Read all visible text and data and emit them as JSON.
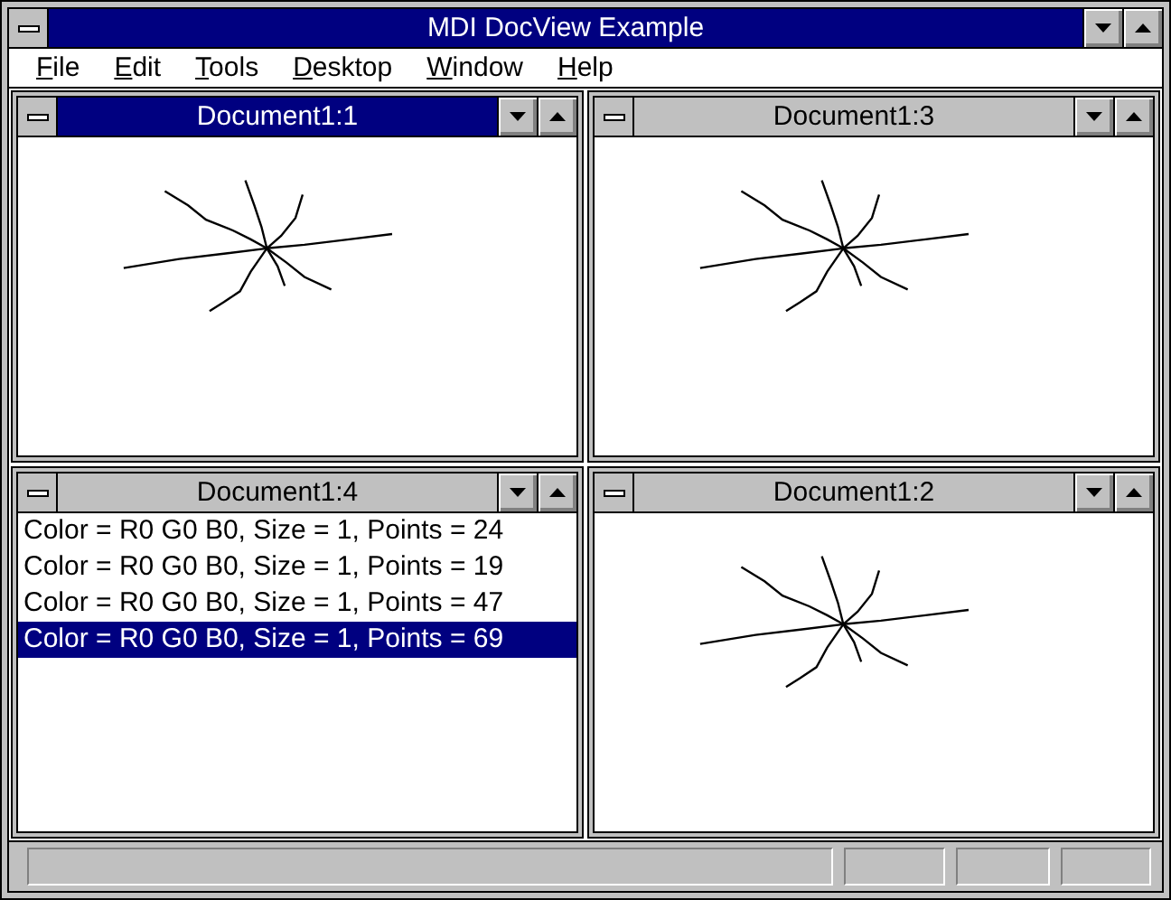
{
  "window": {
    "title": "MDI DocView Example"
  },
  "menu": [
    {
      "label": "File"
    },
    {
      "label": "Edit"
    },
    {
      "label": "Tools"
    },
    {
      "label": "Desktop"
    },
    {
      "label": "Window"
    },
    {
      "label": "Help"
    }
  ],
  "documents": [
    {
      "title": "Document1:1",
      "active": true,
      "kind": "sketch"
    },
    {
      "title": "Document1:3",
      "active": false,
      "kind": "sketch"
    },
    {
      "title": "Document1:4",
      "active": false,
      "kind": "list",
      "items": [
        {
          "text": "Color = R0 G0 B0, Size = 1, Points = 24",
          "selected": false
        },
        {
          "text": "Color = R0 G0 B0, Size = 1, Points = 19",
          "selected": false
        },
        {
          "text": "Color = R0 G0 B0, Size = 1, Points = 47",
          "selected": false
        },
        {
          "text": "Color = R0 G0 B0, Size = 1, Points = 69",
          "selected": true
        }
      ]
    },
    {
      "title": "Document1:2",
      "active": false,
      "kind": "sketch"
    }
  ]
}
